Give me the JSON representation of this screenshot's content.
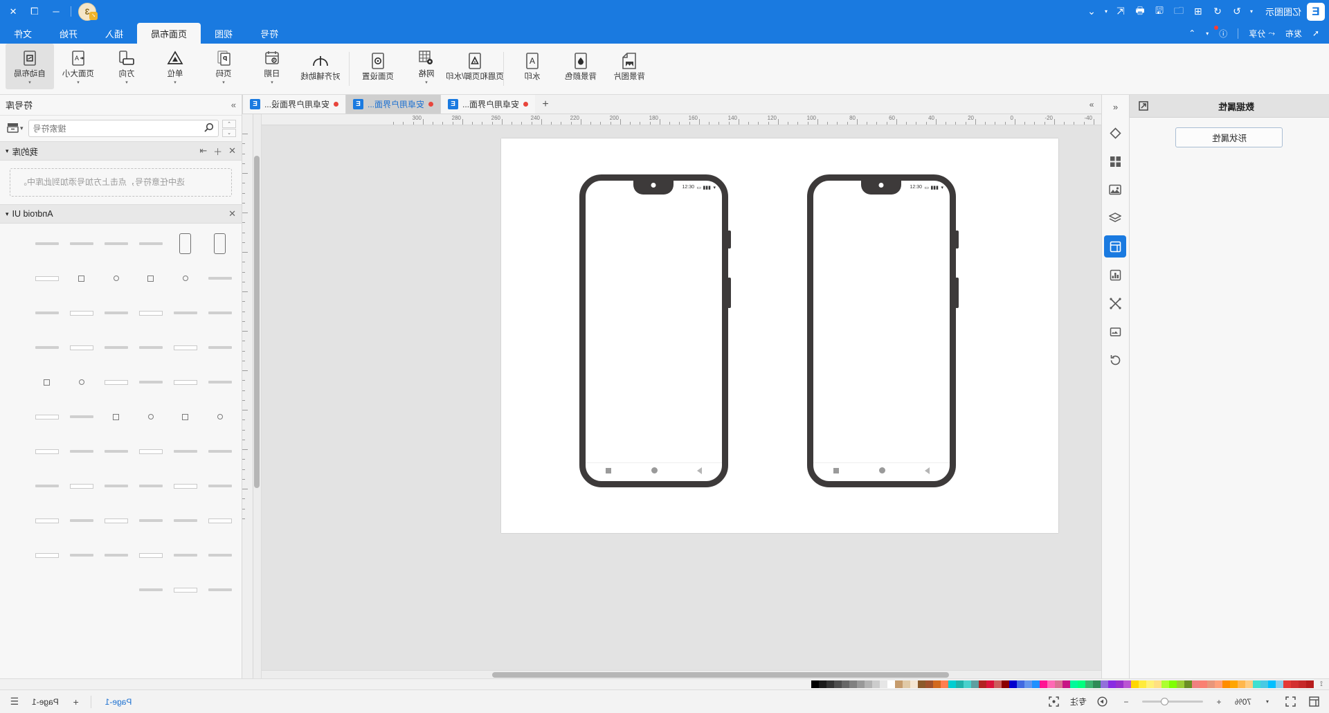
{
  "app": {
    "name": "亿图图示",
    "logo_letter": "E",
    "crown_badge": "3"
  },
  "titlebar": {
    "quick_icons": [
      {
        "name": "new-file-icon",
        "glyph": "▣"
      },
      {
        "name": "undo-icon",
        "glyph": "↺"
      },
      {
        "name": "redo-icon",
        "glyph": "↻"
      },
      {
        "name": "add-icon",
        "glyph": "⊞"
      },
      {
        "name": "open-folder-icon",
        "glyph": "🗀"
      },
      {
        "name": "save-icon",
        "glyph": "💾"
      },
      {
        "name": "print-icon",
        "glyph": "🖶"
      },
      {
        "name": "export-icon",
        "glyph": "⇱"
      },
      {
        "name": "customize-icon",
        "glyph": "▾"
      }
    ],
    "window_buttons": [
      "─",
      "❐",
      "✕"
    ]
  },
  "quickaccess": {
    "publish_label": "发布",
    "share_label": "分享",
    "cursor_icon": "pointer-icon",
    "help_icon": "help-icon",
    "collapse_icon": "chevron-up-icon"
  },
  "tabs": [
    {
      "label": "文件",
      "active": false
    },
    {
      "label": "开始",
      "active": false
    },
    {
      "label": "插入",
      "active": false
    },
    {
      "label": "页面布局",
      "active": true
    },
    {
      "label": "视图",
      "active": false
    },
    {
      "label": "符号",
      "active": false
    }
  ],
  "ribbon": {
    "groups": [
      {
        "items": [
          {
            "label": "自动布局",
            "icon": "auto-layout-icon",
            "selected": true,
            "caret": true
          },
          {
            "label": "页面大小",
            "icon": "page-size-icon",
            "selected": false,
            "caret": true
          },
          {
            "label": "方向",
            "icon": "orientation-icon",
            "selected": false,
            "caret": true
          },
          {
            "label": "单位",
            "icon": "unit-icon",
            "selected": false,
            "caret": true
          },
          {
            "label": "页码",
            "icon": "page-number-icon",
            "selected": false,
            "caret": true
          },
          {
            "label": "日期",
            "icon": "date-icon",
            "selected": false,
            "caret": true
          },
          {
            "label": "对齐辅助线",
            "icon": "align-guide-icon",
            "selected": false,
            "caret": false
          }
        ]
      },
      {
        "items": [
          {
            "label": "页面设置",
            "icon": "page-setup-icon",
            "selected": false,
            "caret": false
          },
          {
            "label": "网格",
            "icon": "grid-icon",
            "selected": false,
            "caret": true
          },
          {
            "label": "页眉和页脚/水印",
            "icon": "header-footer-icon",
            "selected": false,
            "caret": false
          }
        ]
      },
      {
        "items": [
          {
            "label": "水印",
            "icon": "watermark-icon",
            "selected": false,
            "caret": true
          },
          {
            "label": "背景颜色",
            "icon": "bg-color-icon",
            "selected": false,
            "caret": true
          },
          {
            "label": "背景图片",
            "icon": "bg-image-icon",
            "selected": false,
            "caret": true
          }
        ]
      }
    ]
  },
  "left_panel": {
    "title": "数据属性",
    "dock_icon": "dock-panel-icon",
    "button_label": "形状属性"
  },
  "toolstrip": {
    "collapse_icon": "chevrons-left-icon",
    "items": [
      {
        "name": "theme-icon",
        "glyph": "◆",
        "active": false
      },
      {
        "name": "grid-layout-icon",
        "glyph": "▦",
        "active": false
      },
      {
        "name": "image-icon",
        "glyph": "🖼",
        "active": false
      },
      {
        "name": "layers-icon",
        "glyph": "❖",
        "active": false
      },
      {
        "name": "page-properties-icon",
        "glyph": "▤",
        "active": true
      },
      {
        "name": "chart-icon",
        "glyph": "📊",
        "active": false
      },
      {
        "name": "connector-icon",
        "glyph": "⤫",
        "active": false
      },
      {
        "name": "frame-icon",
        "glyph": "🖼",
        "active": false
      },
      {
        "name": "refresh-icon",
        "glyph": "⟳",
        "active": false
      }
    ]
  },
  "canvas_tabs": [
    {
      "label": "安卓用户界面...",
      "active": false,
      "modified": true
    },
    {
      "label": "安卓用户界面...",
      "active": true,
      "modified": true
    },
    {
      "label": "安卓用户界面设...",
      "active": false,
      "modified": true
    }
  ],
  "canvas_tabbar": {
    "add_label": "+",
    "more_label": "»"
  },
  "ruler": {
    "h_labels": [
      "-40",
      "-20",
      "0",
      "20",
      "40",
      "60",
      "80",
      "100",
      "120",
      "140",
      "160",
      "180",
      "200",
      "220",
      "240",
      "260",
      "280",
      "300"
    ],
    "v_labels": [
      "20",
      "40",
      "60",
      "80",
      "100",
      "120",
      "140",
      "160",
      "180",
      "200"
    ]
  },
  "phones": [
    {
      "name": "phone-mockup-left",
      "status_icons": [
        "wifi-icon",
        "signal-icon",
        "battery-icon"
      ],
      "status_time": "12:30",
      "nav": [
        "back-triangle-icon",
        "home-circle-icon",
        "recents-square-icon"
      ]
    },
    {
      "name": "phone-mockup-right",
      "status_icons": [
        "wifi-icon",
        "signal-icon",
        "battery-icon"
      ],
      "status_time": "12:30",
      "nav": [
        "back-triangle-icon",
        "home-circle-icon",
        "recents-square-icon"
      ]
    }
  ],
  "right_panel": {
    "title": "符号库",
    "more_icon": "chevrons-right-icon",
    "library_icon": "library-icon",
    "search_placeholder": "搜索符号",
    "search_value": "",
    "search_icon": "search-icon",
    "spin_up": "⌃",
    "spin_down": "⌄",
    "sections": [
      {
        "title": "我的库",
        "caret": "▾",
        "actions": [
          "import-icon",
          "add-icon",
          "close-icon"
        ],
        "empty_text": "选中任意符号，点击上方加号添加到此库中。"
      },
      {
        "title": "Android UI",
        "caret": "▾",
        "actions": [
          "close-icon"
        ],
        "empty_text": ""
      }
    ]
  },
  "palette": {
    "colors": [
      "#000000",
      "#1a1a1a",
      "#333333",
      "#4d4d4d",
      "#666666",
      "#808080",
      "#999999",
      "#b3b3b3",
      "#cccccc",
      "#e6e6e6",
      "#ffffff",
      "#c69c6d",
      "#e0c9a6",
      "#f5e6d3",
      "#8c5a2b",
      "#a0522d",
      "#d2691e",
      "#ff7f50",
      "#00ced1",
      "#20b2aa",
      "#48d1cc",
      "#5f9ea0",
      "#b22222",
      "#dc143c",
      "#cd5c5c",
      "#8b0000",
      "#0000cd",
      "#4169e1",
      "#6495ed",
      "#1e90ff",
      "#ff1493",
      "#ff69b4",
      "#db7093",
      "#c71585",
      "#00fa9a",
      "#00ff7f",
      "#3cb371",
      "#2e8b57",
      "#9370db",
      "#8a2be2",
      "#9932cc",
      "#ba55d3",
      "#ffd700",
      "#ffeb3b",
      "#fff176",
      "#ffe082",
      "#adff2f",
      "#7fff00",
      "#9acd32",
      "#6b8e23",
      "#f08080",
      "#fa8072",
      "#e9967a",
      "#ffa07a",
      "#ff8c00",
      "#ffa500",
      "#ffb74d",
      "#ffcc80",
      "#40e0d0",
      "#48cae4",
      "#00bfff",
      "#87ceeb",
      "#e53935",
      "#d32f2f",
      "#c62828",
      "#b71c1c"
    ],
    "dropper_icon": "eyedropper-icon"
  },
  "statusbar": {
    "fit_icon": "fit-page-icon",
    "fullscreen_icon": "fullscreen-icon",
    "zoom_value": "70%",
    "zoom_out": "−",
    "zoom_in": "+",
    "zoom_dropdown": "▾",
    "presentation_icon": "presentation-icon",
    "focus_label": "专注",
    "focus_icon": "focus-icon",
    "page_label": "Page-1",
    "page_tab_label": "Page-1",
    "page_add": "+",
    "page_menu": "☰"
  }
}
